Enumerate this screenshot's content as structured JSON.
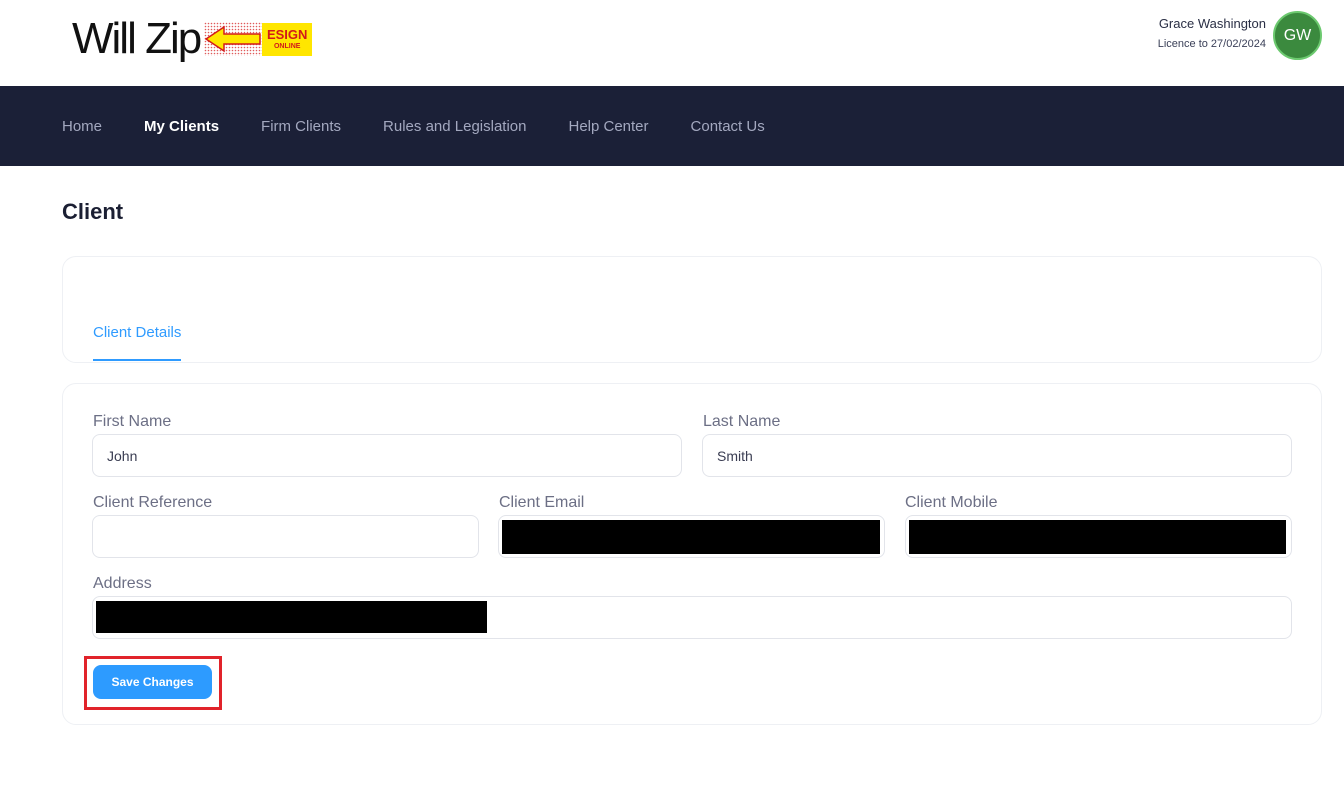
{
  "brand": {
    "logo_text": "Will Zip",
    "badge_main": "ESIGN",
    "badge_sub": "ONLINE",
    "badge_color": "#ffe600",
    "badge_text_color": "#d21a1a"
  },
  "user": {
    "name": "Grace Washington",
    "licence": "Licence to 27/02/2024",
    "initials": "GW",
    "avatar_color": "#3b8a3e"
  },
  "nav": {
    "items": [
      {
        "label": "Home",
        "active": false
      },
      {
        "label": "My Clients",
        "active": true
      },
      {
        "label": "Firm Clients",
        "active": false
      },
      {
        "label": "Rules and Legislation",
        "active": false
      },
      {
        "label": "Help Center",
        "active": false
      },
      {
        "label": "Contact Us",
        "active": false
      }
    ],
    "background": "#1b2037"
  },
  "page": {
    "title": "Client"
  },
  "tabs": [
    {
      "label": "Client Details",
      "active": true
    }
  ],
  "form": {
    "first_name": {
      "label": "First Name",
      "value": "John"
    },
    "last_name": {
      "label": "Last Name",
      "value": "Smith"
    },
    "client_reference": {
      "label": "Client Reference",
      "value": ""
    },
    "client_email": {
      "label": "Client Email"
    },
    "client_mobile": {
      "label": "Client Mobile"
    },
    "address": {
      "label": "Address"
    },
    "save_label": "Save Changes",
    "accent": "#2d9bff",
    "highlight_color": "#e1232a"
  }
}
